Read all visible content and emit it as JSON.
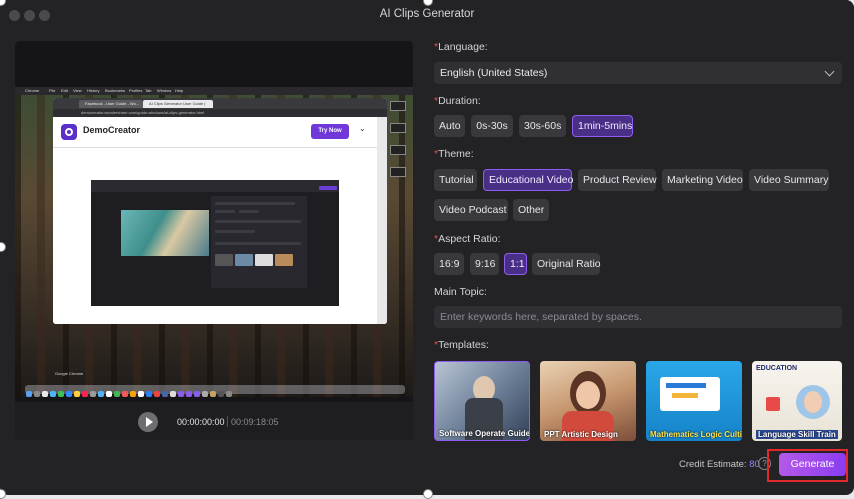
{
  "window": {
    "title": "AI Clips Generator"
  },
  "preview": {
    "menubar": [
      "Chrome",
      "File",
      "Edit",
      "View",
      "History",
      "Bookmarks",
      "Profiles",
      "Tab",
      "Window",
      "Help"
    ],
    "tabs": [
      "Facebook - User Guide - Wo...",
      "AI Clips Generator User Guide |"
    ],
    "url": "democreator.wondershare.com/guide-windows/ai-clips-generator.html",
    "brand": "DemoCreator",
    "try_now": "Try Now",
    "dock_label": "Google Chrome",
    "time_current": "00:00:00:00",
    "time_total": "00:09:18:05"
  },
  "form": {
    "language": {
      "label": "Language:",
      "value": "English (United States)"
    },
    "duration": {
      "label": "Duration:",
      "options": [
        "Auto",
        "0s-30s",
        "30s-60s",
        "1min-5mins"
      ],
      "selected": "1min-5mins"
    },
    "theme": {
      "label": "Theme:",
      "options": [
        "Tutorial",
        "Educational Video",
        "Product Review",
        "Marketing Video",
        "Video Summary",
        "Video Podcast",
        "Other"
      ],
      "selected": "Educational Video"
    },
    "aspect": {
      "label": "Aspect Ratio:",
      "options": [
        "16:9",
        "9:16",
        "1:1",
        "Original Ratio"
      ],
      "selected": "1:1"
    },
    "topic": {
      "label": "Main Topic:",
      "placeholder": "Enter keywords here, separated by spaces."
    },
    "templates": {
      "label": "Templates:",
      "items": [
        {
          "caption": "Software Operate Guide"
        },
        {
          "caption": "PPT Artistic Design"
        },
        {
          "caption": "Mathematics Logic Cultivate"
        },
        {
          "caption": "Language Skill Train",
          "top": "EDUCATION"
        }
      ]
    }
  },
  "footer": {
    "credit_label": "Credit Estimate:",
    "credit_value": "80",
    "help": "?",
    "generate": "Generate"
  },
  "colors": {
    "accent": "#8e5cf0",
    "selected_bg": "#4a2f86",
    "generate_start": "#b459e8",
    "generate_end": "#8a3cf0",
    "highlight": "#e1282a"
  }
}
